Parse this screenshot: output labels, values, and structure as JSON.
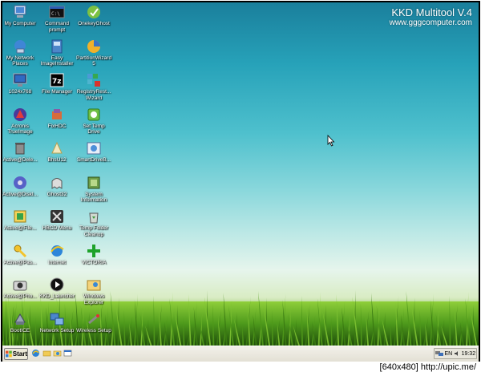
{
  "brand": {
    "title": "KKD Multitool V.4",
    "url": "www.gggcomputer.com"
  },
  "icons": [
    {
      "label": "My Computer",
      "icon": "my-computer-icon"
    },
    {
      "label": "Command prompt",
      "icon": "command-prompt-icon"
    },
    {
      "label": "OnekeyGhost",
      "icon": "onekeyghost-icon"
    },
    {
      "label": "My Network Places",
      "icon": "network-places-icon"
    },
    {
      "label": "Easy ImageInstaller",
      "icon": "easy-image-installer-icon"
    },
    {
      "label": "PartitionWizard 5",
      "icon": "partition-wizard-icon"
    },
    {
      "label": "1024x768",
      "icon": "monitor-icon"
    },
    {
      "label": "File Manager",
      "icon": "7zip-icon"
    },
    {
      "label": "RegistryRest... Wizard",
      "icon": "registry-icon"
    },
    {
      "label": "Acronis TrueImage",
      "icon": "acronis-icon"
    },
    {
      "label": "FixHDC",
      "icon": "fixhdc-icon"
    },
    {
      "label": "Set Temp Drive",
      "icon": "temp-drive-icon"
    },
    {
      "label": "Active@Dele...",
      "icon": "active-delete-icon"
    },
    {
      "label": "BhsU12",
      "icon": "bhsu-icon"
    },
    {
      "label": "SmartDriveB...",
      "icon": "smartdrive-icon"
    },
    {
      "label": "Active@DiskI...",
      "icon": "active-disk-icon"
    },
    {
      "label": "Ghost32",
      "icon": "ghost32-icon"
    },
    {
      "label": "System Information",
      "icon": "system-info-icon"
    },
    {
      "label": "Active@File...",
      "icon": "active-file-icon"
    },
    {
      "label": "HBCD Menu",
      "icon": "hbcd-menu-icon"
    },
    {
      "label": "Temp Folder Cleanup",
      "icon": "recycle-icon"
    },
    {
      "label": "Active@Pas...",
      "icon": "active-password-icon"
    },
    {
      "label": "Internet",
      "icon": "internet-explorer-icon"
    },
    {
      "label": "VICTORIA",
      "icon": "victoria-icon"
    },
    {
      "label": "Active@Pho...",
      "icon": "camera-icon"
    },
    {
      "label": "KKD_Launcher",
      "icon": "launcher-play-icon"
    },
    {
      "label": "Windows Explorer",
      "icon": "windows-explorer-icon"
    },
    {
      "label": "BootICE",
      "icon": "bootice-icon"
    },
    {
      "label": "Network Setup",
      "icon": "network-setup-icon"
    },
    {
      "label": "Wireless Setup",
      "icon": "wireless-icon"
    }
  ],
  "taskbar": {
    "start_label": "Start",
    "tray_lang": "EN",
    "clock": "19:32"
  },
  "footer": "[640x480] http://upic.me/",
  "colors": {
    "sky_top": "#1a7f9c",
    "grass": "#3f7d16",
    "taskbar": "#ece9d8"
  }
}
